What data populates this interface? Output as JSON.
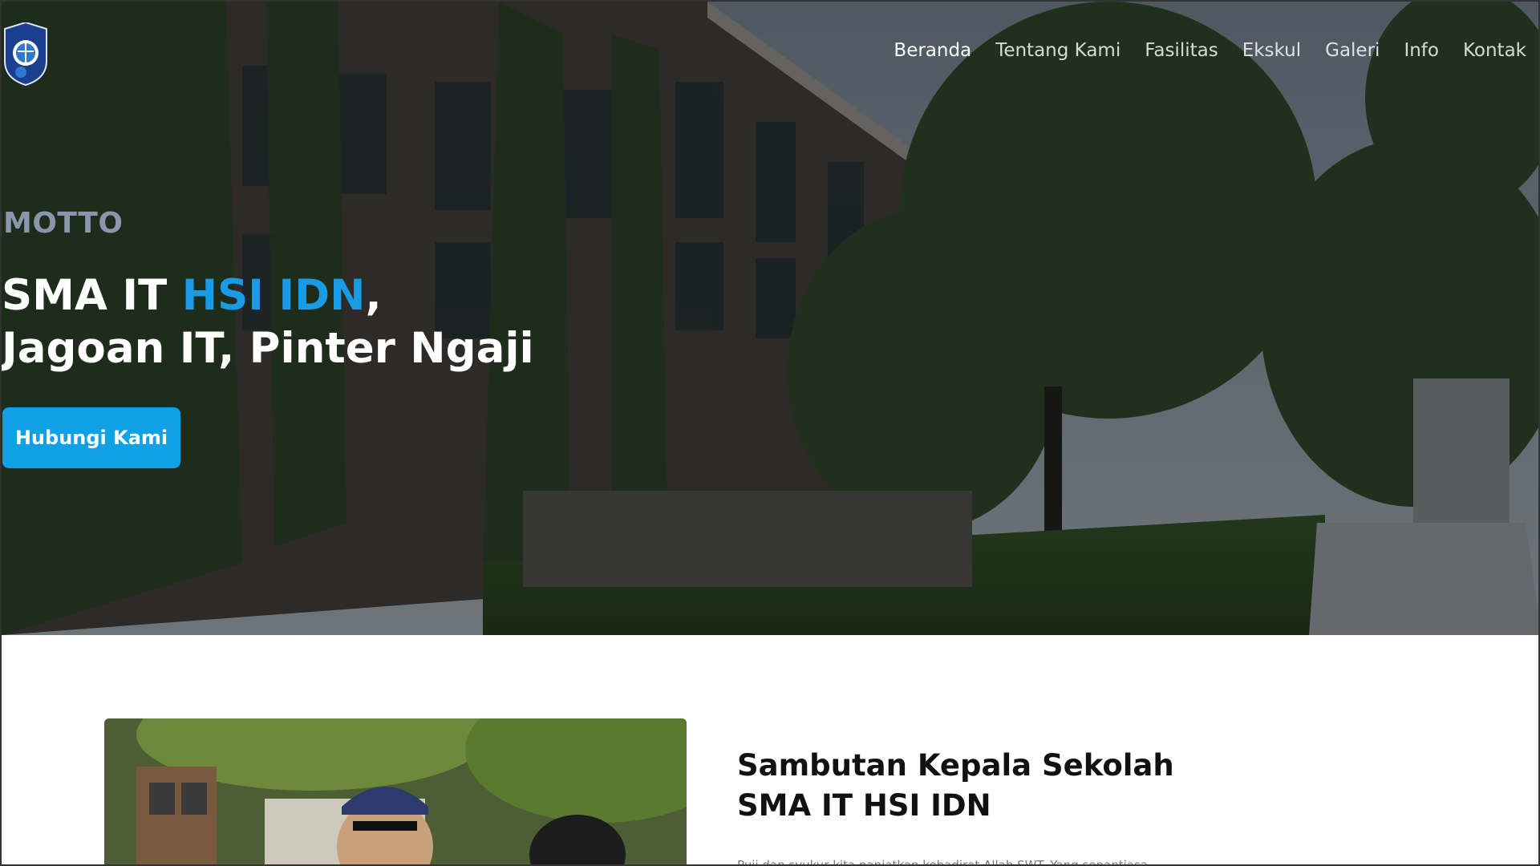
{
  "nav": {
    "items": [
      {
        "label": "Beranda",
        "active": true
      },
      {
        "label": "Tentang Kami",
        "active": false
      },
      {
        "label": "Fasilitas",
        "active": false
      },
      {
        "label": "Ekskul",
        "active": false
      },
      {
        "label": "Galeri",
        "active": false
      },
      {
        "label": "Info",
        "active": false
      },
      {
        "label": "Kontak",
        "active": false
      }
    ]
  },
  "hero": {
    "motto_label": "MOTTO",
    "headline_prefix": "SMA IT ",
    "headline_accent": "HSI IDN",
    "headline_suffix": ",",
    "headline_line2": "Jagoan IT, Pinter Ngaji",
    "cta_label": "Hubungi Kami"
  },
  "welcome": {
    "title_line1": "Sambutan Kepala Sekolah",
    "title_line2": "SMA IT HSI IDN",
    "body_preview": "Puji dan syukur kita panjatkan kehadirat Allah SWT. Yang senantiasa ..."
  },
  "colors": {
    "accent": "#1a9be6",
    "cta": "#0fa0e6",
    "motto": "#8a96ab"
  },
  "icons": {
    "logo": "school-shield-logo"
  }
}
